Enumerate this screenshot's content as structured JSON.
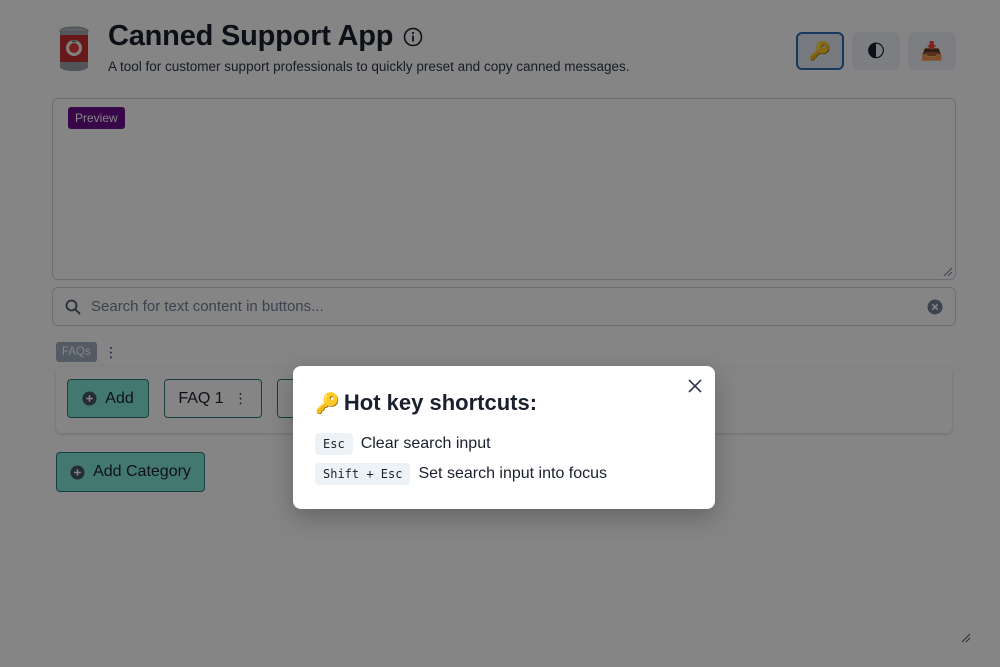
{
  "header": {
    "title": "Canned Support App",
    "subtitle": "A tool for customer support professionals to quickly preset and copy canned messages.",
    "logo_icon": "tomato-can-icon",
    "info_icon": "info-icon",
    "actions": [
      {
        "name": "hotkeys-button",
        "icon": "🔑",
        "active": true
      },
      {
        "name": "theme-toggle-button",
        "icon": "🌓",
        "active": false
      },
      {
        "name": "import-export-button",
        "icon": "📥",
        "active": false
      }
    ]
  },
  "preview": {
    "badge": "Preview",
    "value": ""
  },
  "search": {
    "placeholder": "Search for text content in buttons...",
    "value": ""
  },
  "category": {
    "name": "FAQs",
    "add_label": "Add",
    "buttons": [
      "FAQ 1"
    ]
  },
  "add_category_label": "Add Category",
  "modal": {
    "title_icon": "🔑",
    "title": "Hot key shortcuts:",
    "shortcuts": [
      {
        "keys": "Esc",
        "desc": "Clear search input"
      },
      {
        "keys": "Shift + Esc",
        "desc": "Set search input into focus"
      }
    ]
  },
  "colors": {
    "accent_teal": "#81e6d9",
    "teal_border": "#2c7a7b",
    "preview_badge": "#6b0f8f",
    "active_border": "#2b6cb0"
  }
}
